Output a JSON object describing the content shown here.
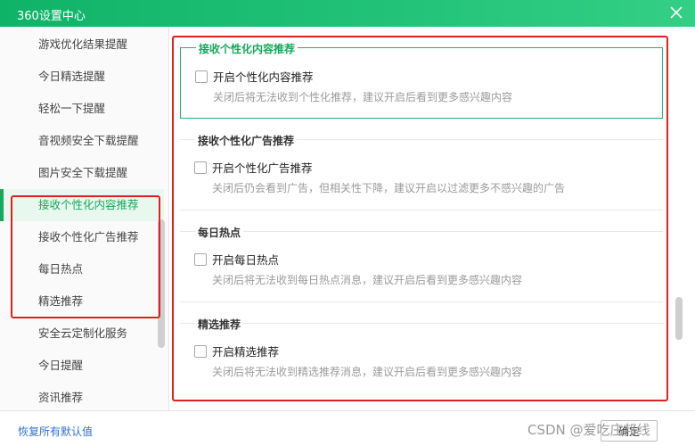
{
  "window": {
    "title": "360设置中心"
  },
  "sidebar": {
    "items": [
      {
        "label": "游戏优化结果提醒"
      },
      {
        "label": "今日精选提醒"
      },
      {
        "label": "轻松一下提醒"
      },
      {
        "label": "音视频安全下载提醒"
      },
      {
        "label": "图片安全下载提醒"
      },
      {
        "label": "接收个性化内容推荐"
      },
      {
        "label": "接收个性化广告推荐"
      },
      {
        "label": "每日热点"
      },
      {
        "label": "精选推荐"
      },
      {
        "label": "安全云定制化服务"
      },
      {
        "label": "今日提醒"
      },
      {
        "label": "资讯推荐"
      }
    ],
    "active_index": 5
  },
  "sections": [
    {
      "title": "接收个性化内容推荐",
      "checkbox_label": "开启个性化内容推荐",
      "checked": false,
      "description": "关闭后将无法收到个性化推荐，建议开启后看到更多感兴趣内容"
    },
    {
      "title": "接收个性化广告推荐",
      "checkbox_label": "开启个性化广告推荐",
      "checked": false,
      "description": "关闭后仍会看到广告，但相关性下降，建议开启以过滤更多不感兴趣的广告"
    },
    {
      "title": "每日热点",
      "checkbox_label": "开启每日热点",
      "checked": false,
      "description": "关闭后将无法收到每日热点消息，建议开启后看到更多感兴趣内容"
    },
    {
      "title": "精选推荐",
      "checkbox_label": "开启精选推荐",
      "checked": false,
      "description": "关闭后将无法收到精选推荐消息，建议开启后看到更多感兴趣内容"
    }
  ],
  "footer": {
    "restore_label": "恢复所有默认值",
    "confirm_label": "确定"
  },
  "watermark": "CSDN @爱吃庄邦线",
  "colors": {
    "accent": "#16a85b",
    "highlight_box": "#e02020",
    "link": "#2e6fd8"
  }
}
